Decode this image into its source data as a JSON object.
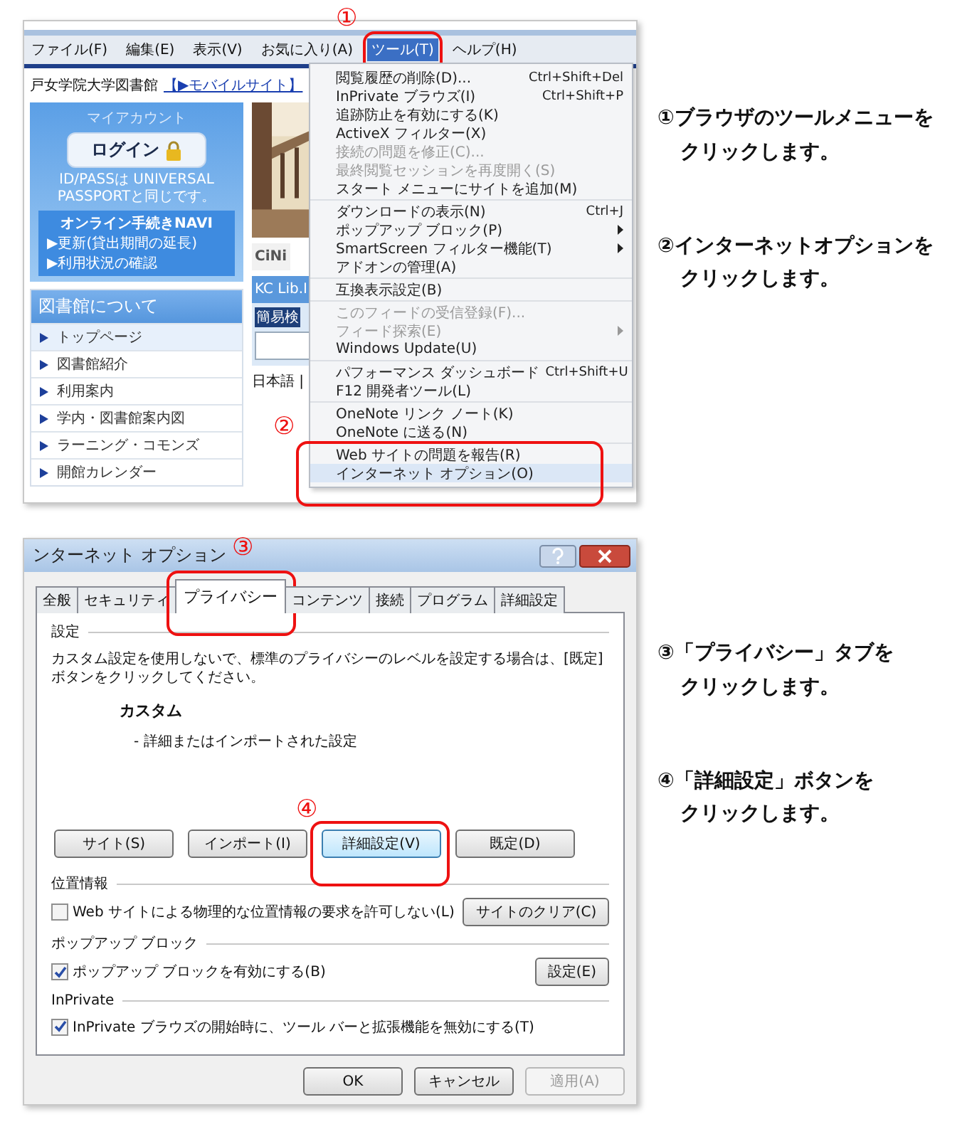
{
  "browser": {
    "menubar": [
      {
        "label": "ファイル(F)",
        "selected": false
      },
      {
        "label": "編集(E)",
        "selected": false
      },
      {
        "label": "表示(V)",
        "selected": false
      },
      {
        "label": "お気に入り(A)",
        "selected": false
      },
      {
        "label": "ツール(T)",
        "selected": true,
        "callout": "①"
      },
      {
        "label": "ヘルプ(H)",
        "selected": false
      }
    ],
    "site_title": "戸女学院大学図書館",
    "mobile_link": "【▶モバイルサイト】",
    "account": {
      "title": "マイアカウント",
      "login": "ログイン",
      "note": "ID/PASSは UNIVERSAL PASSPORTと同じです。",
      "navi_title": "オンライン手続きNAVI",
      "navi_links": [
        "▶更新(貸出期間の延長)",
        "▶利用状況の確認"
      ]
    },
    "nav": {
      "title": "図書館について",
      "items": [
        {
          "label": "トップページ",
          "selected": true
        },
        {
          "label": "図書館紹介",
          "selected": false
        },
        {
          "label": "利用案内",
          "selected": false
        },
        {
          "label": "学内・図書館案内図",
          "selected": false
        },
        {
          "label": "ラーニング・コモンズ",
          "selected": false
        },
        {
          "label": "開館カレンダー",
          "selected": false
        }
      ]
    },
    "content": {
      "tab": "CiNi",
      "box_title": "KC Lib.I",
      "search_label": "簡易検",
      "language": "日本語 |"
    },
    "tools_menu": {
      "groups": [
        {
          "items": [
            {
              "label": "閲覧履歴の削除(D)...",
              "shortcut": "Ctrl+Shift+Del",
              "disabled": false,
              "submenu": false,
              "selected": false
            },
            {
              "label": "InPrivate ブラウズ(I)",
              "shortcut": "Ctrl+Shift+P",
              "disabled": false,
              "submenu": false,
              "selected": false
            },
            {
              "label": "追跡防止を有効にする(K)",
              "disabled": false,
              "submenu": false,
              "selected": false
            },
            {
              "label": "ActiveX フィルター(X)",
              "disabled": false,
              "submenu": false,
              "selected": false
            },
            {
              "label": "接続の問題を修正(C)...",
              "disabled": true,
              "submenu": false,
              "selected": false
            },
            {
              "label": "最終閲覧セッションを再度開く(S)",
              "disabled": true,
              "submenu": false,
              "selected": false
            },
            {
              "label": "スタート メニューにサイトを追加(M)",
              "disabled": false,
              "submenu": false,
              "selected": false
            }
          ]
        },
        {
          "items": [
            {
              "label": "ダウンロードの表示(N)",
              "shortcut": "Ctrl+J",
              "disabled": false,
              "submenu": false,
              "selected": false
            },
            {
              "label": "ポップアップ ブロック(P)",
              "disabled": false,
              "submenu": true,
              "selected": false
            },
            {
              "label": "SmartScreen フィルター機能(T)",
              "disabled": false,
              "submenu": true,
              "selected": false
            },
            {
              "label": "アドオンの管理(A)",
              "disabled": false,
              "submenu": false,
              "selected": false
            }
          ]
        },
        {
          "items": [
            {
              "label": "互換表示設定(B)",
              "disabled": false,
              "submenu": false,
              "selected": false
            }
          ]
        },
        {
          "items": [
            {
              "label": "このフィードの受信登録(F)...",
              "disabled": true,
              "submenu": false,
              "selected": false
            },
            {
              "label": "フィード探索(E)",
              "disabled": true,
              "submenu": true,
              "selected": false
            },
            {
              "label": "Windows Update(U)",
              "disabled": false,
              "submenu": false,
              "selected": false
            }
          ]
        },
        {
          "items": [
            {
              "label": "パフォーマンス ダッシュボード",
              "shortcut": "Ctrl+Shift+U",
              "disabled": false,
              "submenu": false,
              "selected": false
            },
            {
              "label": "F12 開発者ツール(L)",
              "disabled": false,
              "submenu": false,
              "selected": false
            }
          ]
        },
        {
          "items": [
            {
              "label": "OneNote リンク ノート(K)",
              "disabled": false,
              "submenu": false,
              "selected": false
            },
            {
              "label": "OneNote に送る(N)",
              "disabled": false,
              "submenu": false,
              "selected": false
            }
          ]
        },
        {
          "callout": "②",
          "items": [
            {
              "label": "Web サイトの問題を報告(R)",
              "disabled": false,
              "submenu": false,
              "selected": false
            },
            {
              "label": "インターネット オプション(O)",
              "disabled": false,
              "submenu": false,
              "selected": true
            }
          ]
        }
      ]
    }
  },
  "dialog": {
    "title": "ンターネット オプション",
    "tabs": [
      {
        "label": "全般",
        "selected": false
      },
      {
        "label": "セキュリティ",
        "selected": false
      },
      {
        "label": "プライバシー",
        "selected": true,
        "callout": "③"
      },
      {
        "label": "コンテンツ",
        "selected": false
      },
      {
        "label": "接続",
        "selected": false
      },
      {
        "label": "プログラム",
        "selected": false
      },
      {
        "label": "詳細設定",
        "selected": false
      }
    ],
    "settings": {
      "title": "設定",
      "description": "カスタム設定を使用しないで、標準のプライバシーのレベルを設定する場合は、[既定] ボタンをクリックしてください。",
      "level": "カスタム",
      "level_note": "- 詳細またはインポートされた設定"
    },
    "buttons": [
      {
        "label": "サイト(S)",
        "focused": false
      },
      {
        "label": "インポート(I)",
        "focused": false
      },
      {
        "label": "詳細設定(V)",
        "focused": true,
        "callout": "④"
      },
      {
        "label": "既定(D)",
        "focused": false
      }
    ],
    "sections": [
      {
        "title": "位置情報",
        "option": {
          "label": "Web サイトによる物理的な位置情報の要求を許可しない(L)",
          "checked": false
        },
        "button": "サイトのクリア(C)"
      },
      {
        "title": "ポップアップ ブロック",
        "option": {
          "label": "ポップアップ ブロックを有効にする(B)",
          "checked": true
        },
        "button": "設定(E)"
      },
      {
        "title": "InPrivate",
        "option": {
          "label": "InPrivate ブラウズの開始時に、ツール バーと拡張機能を無効にする(T)",
          "checked": true
        }
      }
    ],
    "footer": [
      {
        "label": "OK",
        "disabled": false
      },
      {
        "label": "キャンセル",
        "disabled": false
      },
      {
        "label": "適用(A)",
        "disabled": true
      }
    ]
  },
  "steps": [
    {
      "lines": [
        "①ブラウザのツールメニューを",
        "クリックします。"
      ]
    },
    {
      "lines": [
        "②インターネットオプションを",
        "クリックします。"
      ]
    },
    {
      "lines": [
        "③「プライバシー」タブを",
        "クリックします。"
      ]
    },
    {
      "lines": [
        "④「詳細設定」ボタンを",
        "クリックします。"
      ]
    }
  ]
}
